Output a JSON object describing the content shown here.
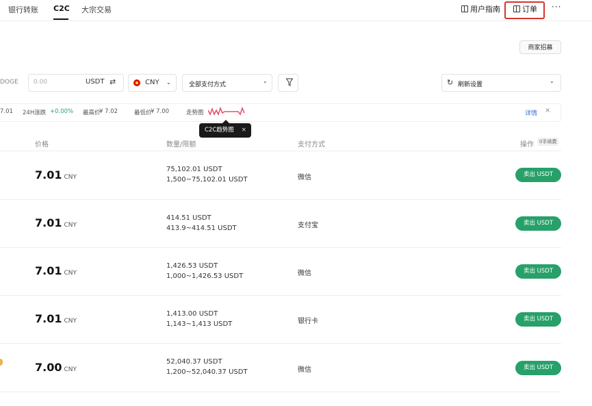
{
  "nav": {
    "tabs": [
      {
        "label": "银行转账"
      },
      {
        "label": "C2C"
      },
      {
        "label": "大宗交易"
      }
    ],
    "user_guide": "用户指南",
    "orders": "订单",
    "more": "···"
  },
  "merchant_button": "商家招募",
  "filters": {
    "coin_partial": "DOGE",
    "amount_placeholder": "0.00",
    "amount_unit": "USDT",
    "currency": "CNY",
    "payment": "全部支付方式",
    "refresh": "刷新设置"
  },
  "stats": {
    "last_price_partial": "7.01",
    "change_label": "24H涨跌",
    "change_value": "+0.00%",
    "high_label": "最高价",
    "high_value": "¥ 7.02",
    "low_label": "最低价",
    "low_value": "¥ 7.00",
    "trend_label": "走势图",
    "details": "详情",
    "close": "×"
  },
  "tooltip": {
    "text": "C2C趋势图",
    "close": "×"
  },
  "table": {
    "headers": {
      "price": "价格",
      "quantity": "数量/限额",
      "payment": "支付方式",
      "action": "操作",
      "fee": "0手续费"
    },
    "rows": [
      {
        "price": "7.01",
        "unit": "CNY",
        "amount": "75,102.01 USDT",
        "limit": "1,500~75,102.01 USDT",
        "payment": "微信",
        "action": "卖出 USDT"
      },
      {
        "price": "7.01",
        "unit": "CNY",
        "amount": "414.51 USDT",
        "limit": "413.9~414.51 USDT",
        "payment": "支付宝",
        "action": "卖出 USDT"
      },
      {
        "price": "7.01",
        "unit": "CNY",
        "amount": "1,426.53 USDT",
        "limit": "1,000~1,426.53 USDT",
        "payment": "微信",
        "action": "卖出 USDT"
      },
      {
        "price": "7.01",
        "unit": "CNY",
        "amount": "1,413.00 USDT",
        "limit": "1,143~1,413 USDT",
        "payment": "银行卡",
        "action": "卖出 USDT"
      },
      {
        "price": "7.00",
        "unit": "CNY",
        "amount": "52,040.37 USDT",
        "limit": "1,200~52,040.37 USDT",
        "payment": "微信",
        "action": "卖出 USDT"
      }
    ]
  },
  "colors": {
    "accent_green": "#27a06a",
    "highlight_red": "#d3332c",
    "link_blue": "#2f6fd6",
    "spark_pink": "#e0566b"
  }
}
